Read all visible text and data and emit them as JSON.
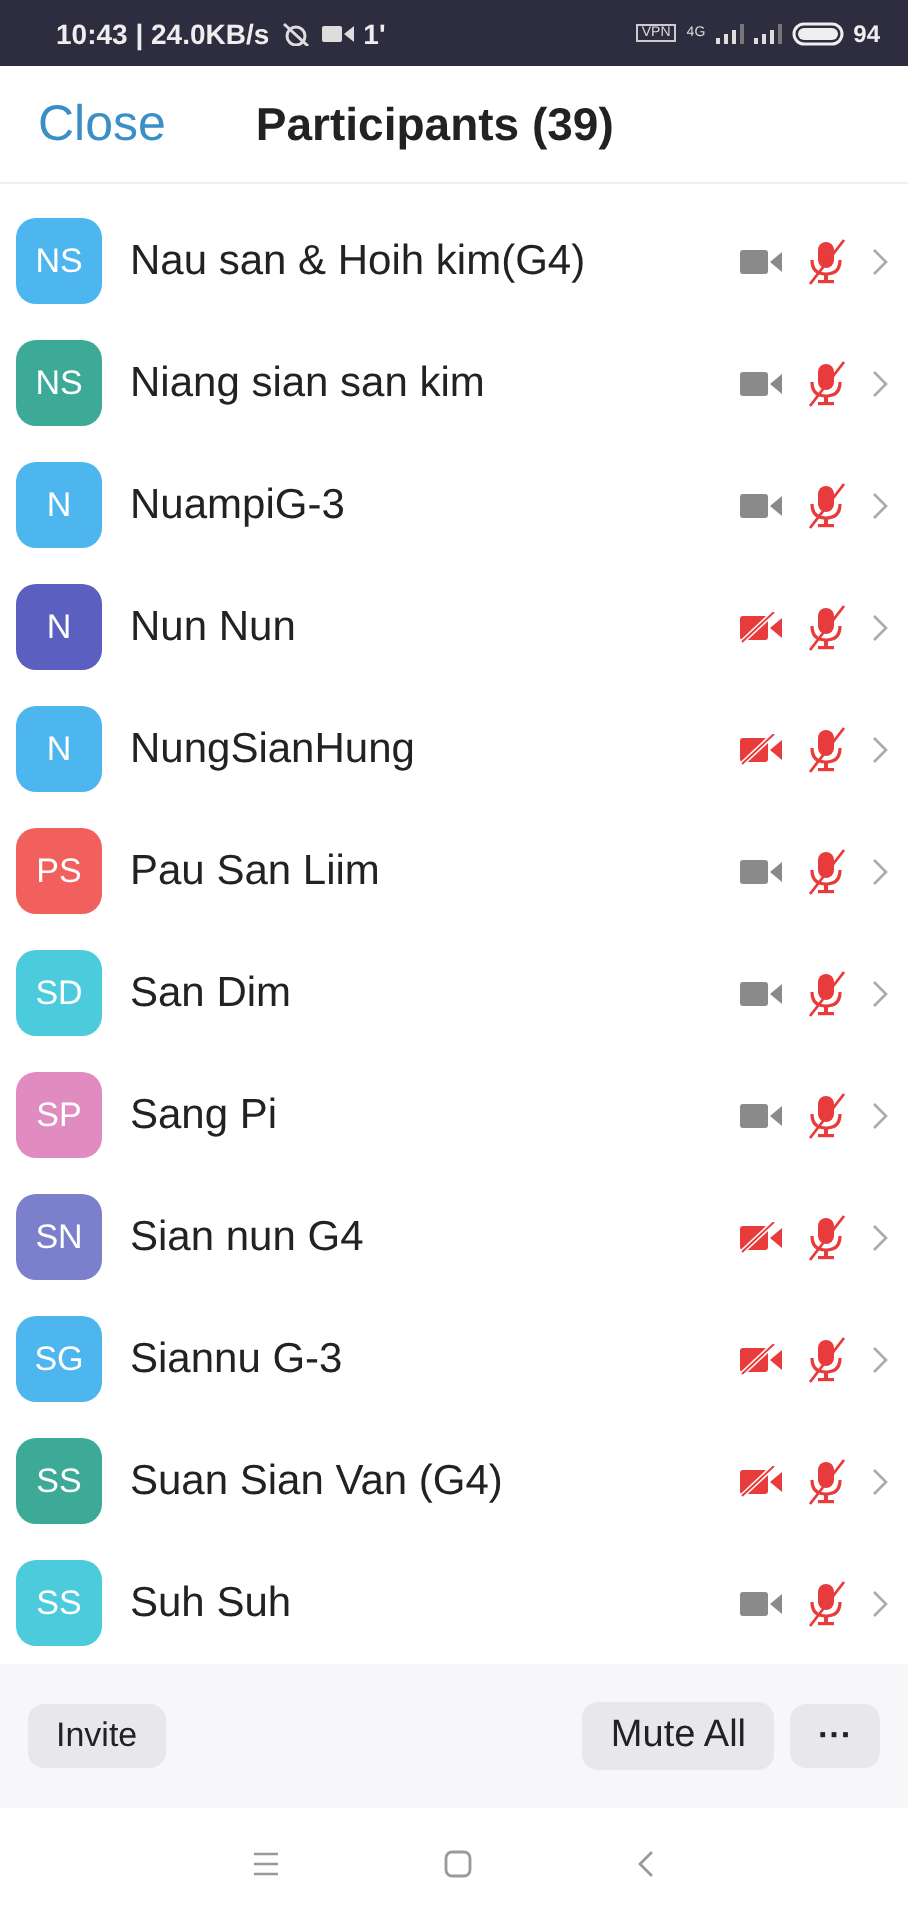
{
  "status_bar": {
    "time": "10:43 | 24.0KB/s",
    "upload": "1'",
    "vpn": "VPN",
    "network": "4G",
    "battery": "94"
  },
  "header": {
    "close": "Close",
    "title": "Participants (39)"
  },
  "participants": [
    {
      "initials": "NS",
      "name": "Nau san & Hoih kim(G4)",
      "color": "#4db6ef",
      "video_on": true,
      "muted": true
    },
    {
      "initials": "NS",
      "name": "Niang sian san kim",
      "color": "#3daa98",
      "video_on": true,
      "muted": true
    },
    {
      "initials": "N",
      "name": "NuampiG-3",
      "color": "#4db6ef",
      "video_on": true,
      "muted": true
    },
    {
      "initials": "N",
      "name": "Nun Nun",
      "color": "#5a5fc0",
      "video_on": false,
      "muted": true
    },
    {
      "initials": "N",
      "name": "NungSianHung",
      "color": "#4db6ef",
      "video_on": false,
      "muted": true
    },
    {
      "initials": "PS",
      "name": "Pau San Liim",
      "color": "#f2605e",
      "video_on": true,
      "muted": true
    },
    {
      "initials": "SD",
      "name": "San Dim",
      "color": "#4ccbdc",
      "video_on": true,
      "muted": true
    },
    {
      "initials": "SP",
      "name": "Sang Pi",
      "color": "#e08cc0",
      "video_on": true,
      "muted": true
    },
    {
      "initials": "SN",
      "name": "Sian nun G4",
      "color": "#7c80cc",
      "video_on": false,
      "muted": true
    },
    {
      "initials": "SG",
      "name": "Siannu G-3",
      "color": "#4db6ef",
      "video_on": false,
      "muted": true
    },
    {
      "initials": "SS",
      "name": "Suan Sian Van (G4)",
      "color": "#3daa98",
      "video_on": false,
      "muted": true
    },
    {
      "initials": "SS",
      "name": "Suh Suh",
      "color": "#4ccbdc",
      "video_on": true,
      "muted": true
    }
  ],
  "footer": {
    "invite": "Invite",
    "mute_all": "Mute All",
    "more": "···"
  }
}
